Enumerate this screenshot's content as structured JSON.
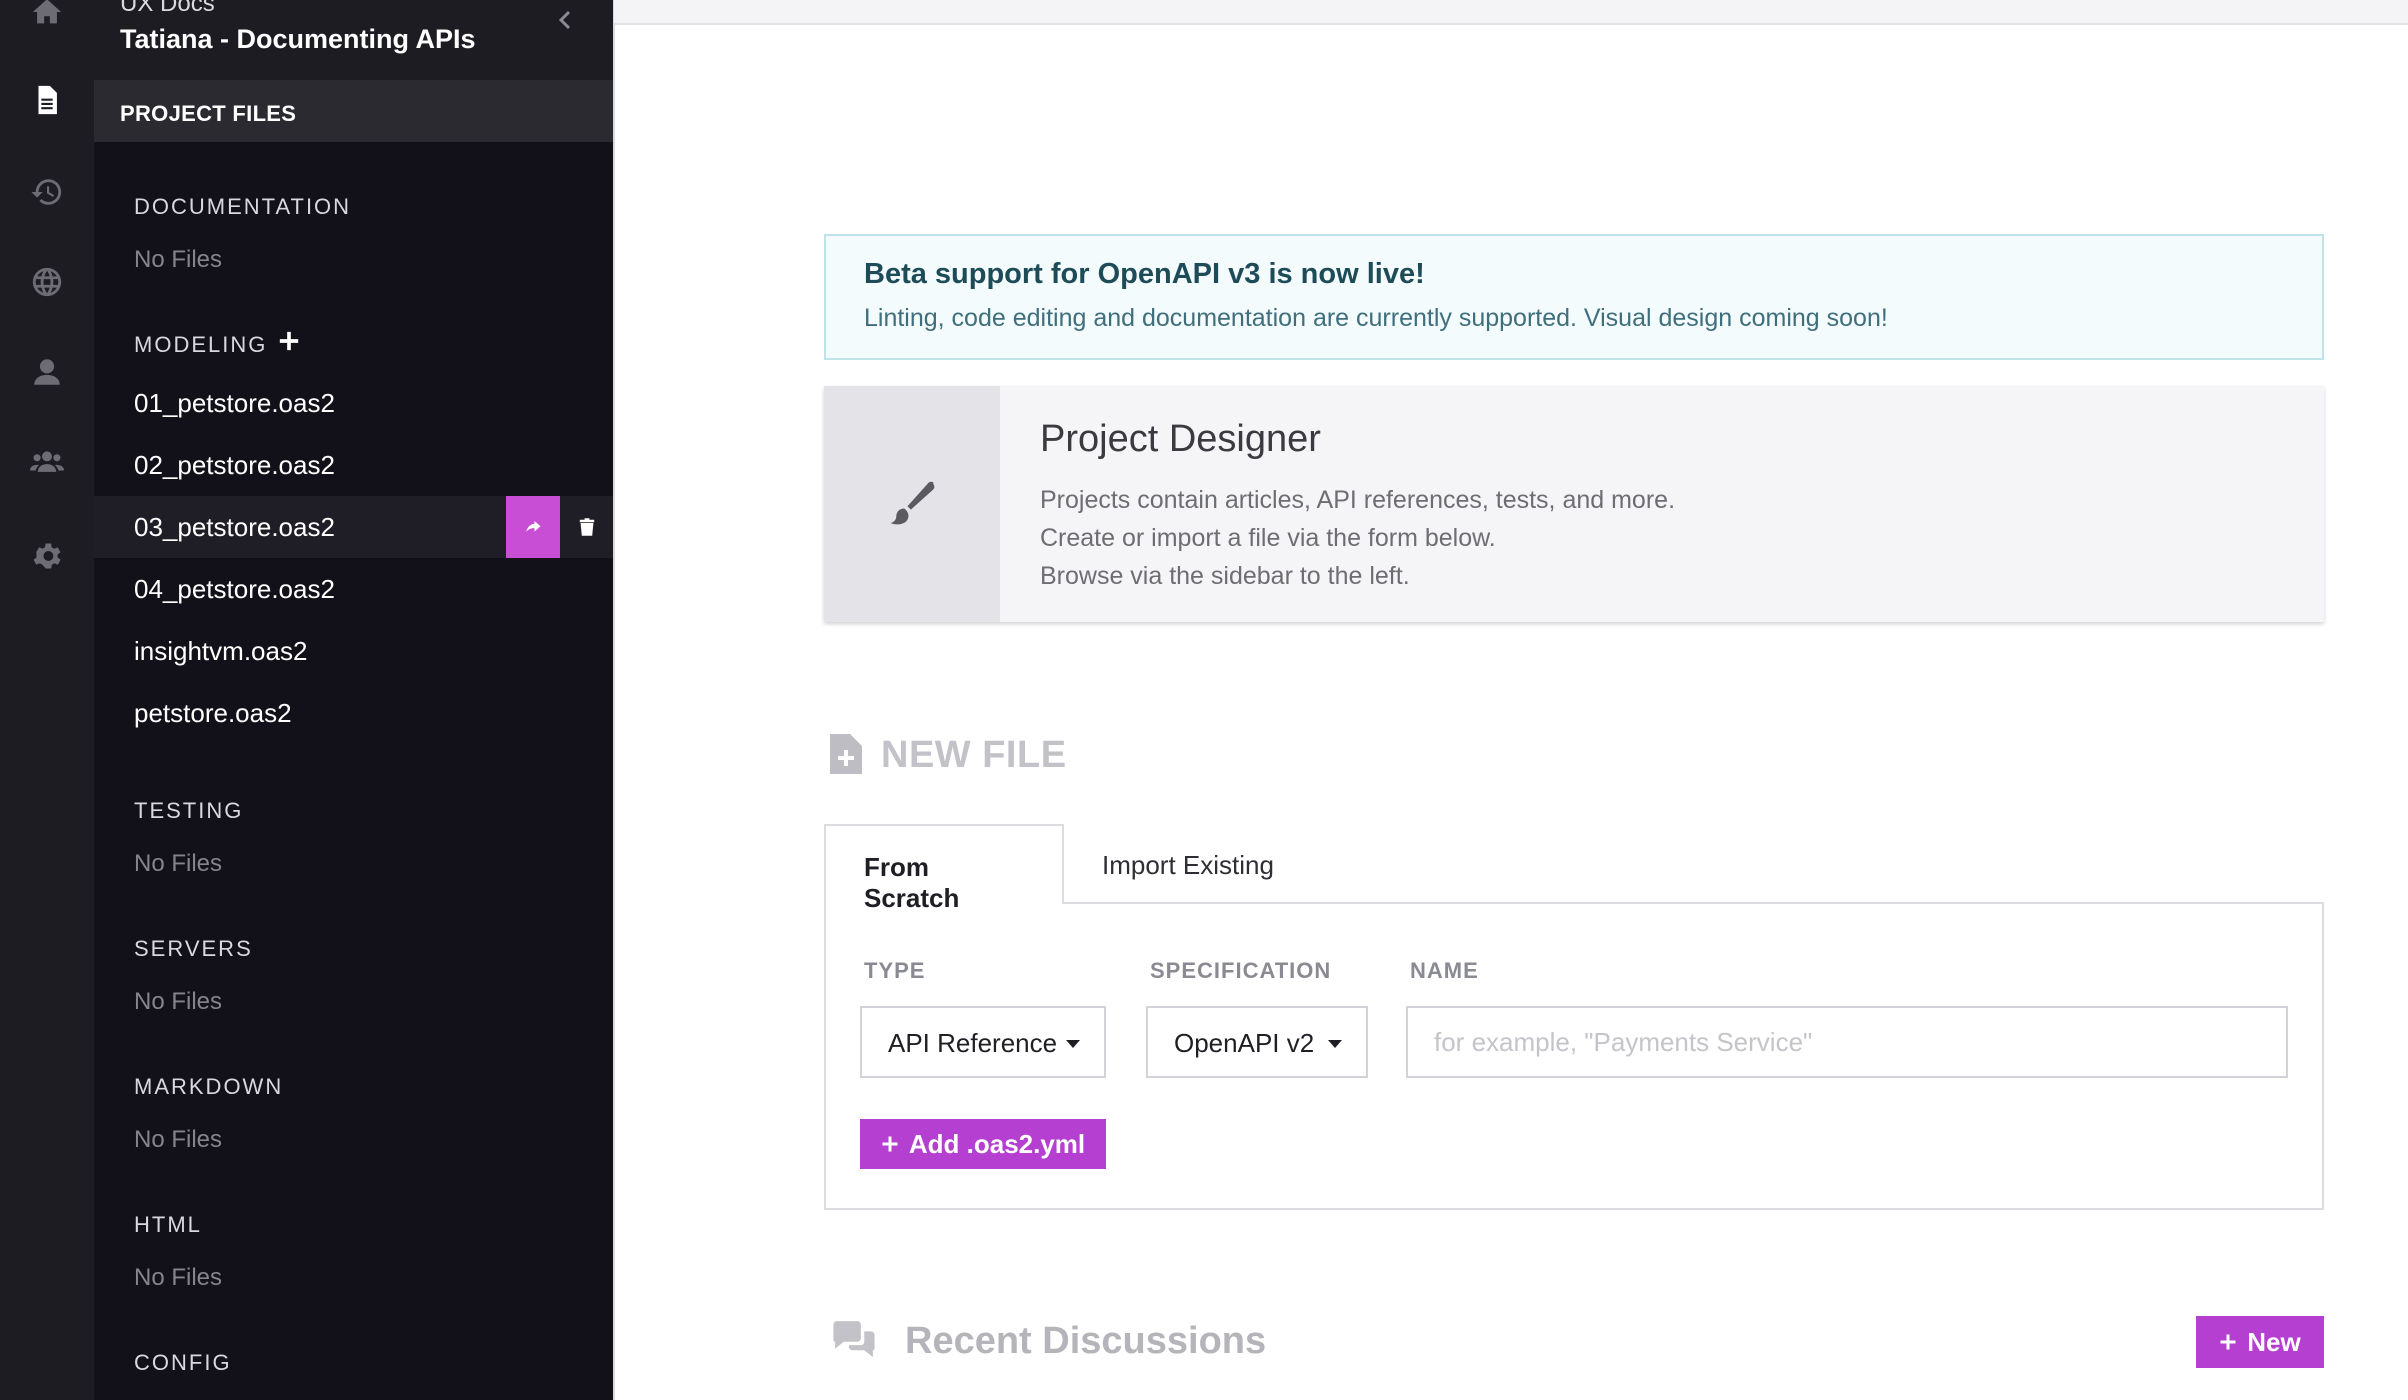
{
  "project": {
    "org": "UX Docs",
    "name": "Tatiana - Documenting APIs",
    "files_header": "PROJECT FILES"
  },
  "rail": {
    "icons": [
      "home-icon",
      "file-icon",
      "history-icon",
      "globe-icon",
      "user-icon",
      "team-icon",
      "gear-icon"
    ],
    "active": "file-icon"
  },
  "sections": {
    "documentation": {
      "label": "DOCUMENTATION",
      "empty": "No Files"
    },
    "modeling": {
      "label": "MODELING",
      "files": [
        "01_petstore.oas2",
        "02_petstore.oas2",
        "03_petstore.oas2",
        "04_petstore.oas2",
        "insightvm.oas2",
        "petstore.oas2"
      ]
    },
    "testing": {
      "label": "TESTING",
      "empty": "No Files"
    },
    "servers": {
      "label": "SERVERS",
      "empty": "No Files"
    },
    "markdown": {
      "label": "MARKDOWN",
      "empty": "No Files"
    },
    "html": {
      "label": "HTML",
      "empty": "No Files"
    },
    "config": {
      "label": "CONFIG"
    }
  },
  "alert": {
    "title": "Beta support for OpenAPI v3 is now live!",
    "text": "Linting, code editing and documentation are currently supported. Visual design coming soon!"
  },
  "designer": {
    "title": "Project Designer",
    "lines": [
      "Projects contain articles, API references, tests, and more.",
      "Create or import a file via the form below.",
      "Browse via the sidebar to the left."
    ]
  },
  "new_file": {
    "title": "NEW FILE",
    "tabs": [
      "From Scratch",
      "Import Existing"
    ],
    "type_label": "TYPE",
    "type_value": "API Reference",
    "spec_label": "SPECIFICATION",
    "spec_value": "OpenAPI v2",
    "name_label": "NAME",
    "name_placeholder": "for example, \"Payments Service\"",
    "add_button": "Add .oas2.yml"
  },
  "discussions": {
    "title": "Recent Discussions",
    "new_button": "New"
  },
  "colors": {
    "accent": "#b43fd0",
    "sidebar_bg": "#121119",
    "rail_bg": "#1d1c22",
    "alert_bg": "#f3fbfc"
  }
}
